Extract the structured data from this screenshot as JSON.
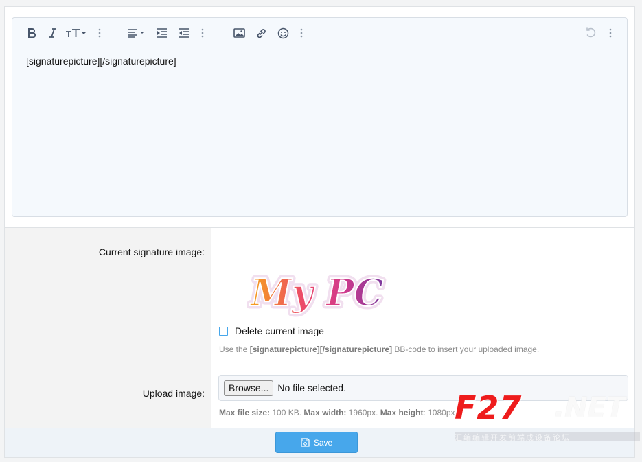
{
  "toolbar": {
    "bold_icon": "bold-icon",
    "italic_icon": "italic-icon",
    "font_size_icon": "font-size-icon",
    "align_icon": "align-left-icon",
    "indent_icon": "indent-icon",
    "outdent_icon": "outdent-icon",
    "image_icon": "image-icon",
    "link_icon": "link-icon",
    "emoji_icon": "smile-icon",
    "undo_icon": "undo-icon",
    "more_icon": "more-vertical-icon"
  },
  "editor": {
    "content": "[signaturepicture][/signaturepicture]"
  },
  "form": {
    "current_label": "Current signature image:",
    "signature_image_text": "My PC",
    "delete_label": "Delete current image",
    "hint_prefix": "Use the ",
    "hint_code": "[signaturepicture][/signaturepicture]",
    "hint_suffix": " BB-code to insert your uploaded image.",
    "upload_label": "Upload image:",
    "browse_label": "Browse...",
    "no_file": "No file selected.",
    "limits": {
      "size_label": "Max file size:",
      "size_value": " 100 KB. ",
      "width_label": "Max width:",
      "width_value": " 1960px. ",
      "height_label": "Max height",
      "height_value": ": 1080px"
    }
  },
  "footer": {
    "save_label": "Save"
  },
  "watermark": {
    "brand": "F27",
    "ghost": ".NET",
    "sub": "汇编编辑开发前端成设备论坛"
  },
  "colors": {
    "accent": "#47a7eb",
    "editor_bg": "#f5f9fd",
    "label_bg": "#f3f3f3",
    "footer_bg": "#eef3f8",
    "watermark_red": "#ee1c1c"
  }
}
